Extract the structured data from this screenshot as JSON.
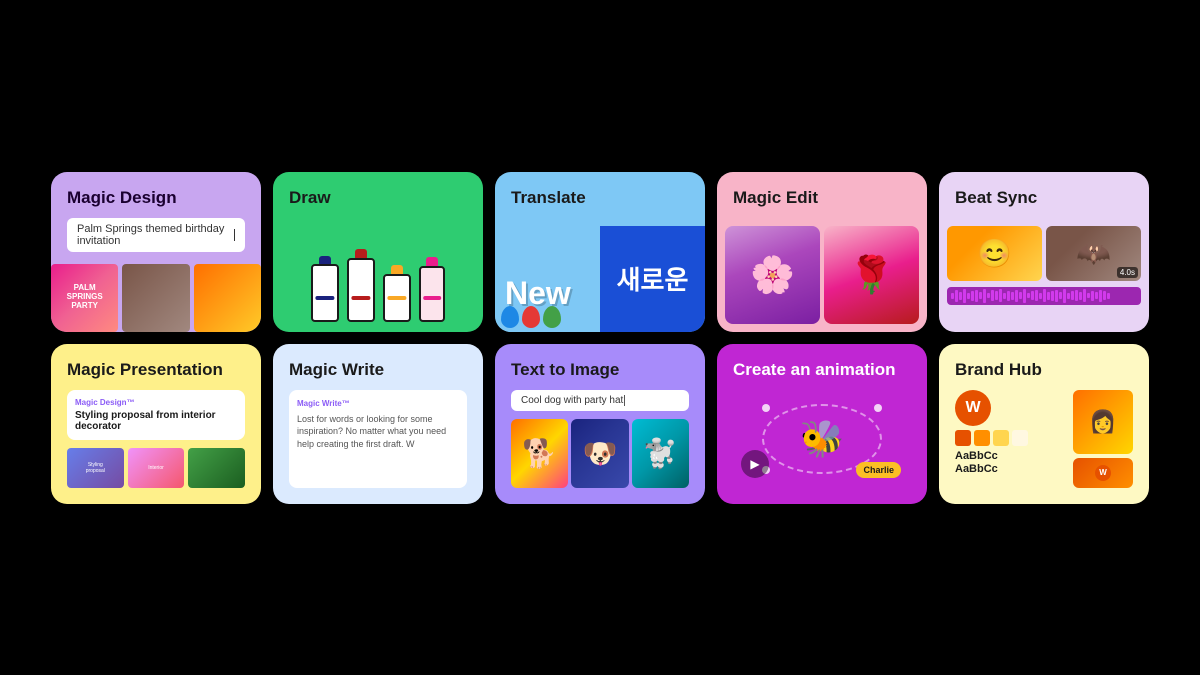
{
  "cards": {
    "magic_design": {
      "title": "Magic Design",
      "input_text": "Palm Springs themed birthday invitation",
      "images": [
        "pink-party",
        "photo",
        "bright"
      ]
    },
    "draw": {
      "title": "Draw"
    },
    "translate": {
      "title": "Translate",
      "word_new": "New",
      "word_korean": "새로운"
    },
    "magic_edit": {
      "title": "Magic Edit"
    },
    "beat_sync": {
      "title": "Beat Sync",
      "duration": "4.0s"
    },
    "magic_presentation": {
      "title": "Magic Presentation",
      "badge": "Magic Design™",
      "proposal": "Styling proposal from interior decorator"
    },
    "magic_write": {
      "title": "Magic Write",
      "badge": "Magic Write™",
      "text": "Lost for words or looking for some inspiration? No matter what you need help creating the first draft. W"
    },
    "text_to_image": {
      "title": "Text to Image",
      "input_text": "Cool dog with party hat"
    },
    "create_animation": {
      "title": "Create an animation",
      "charlie_label": "Charlie"
    },
    "brand_hub": {
      "title": "Brand Hub",
      "typography": "AaBbCc\nAaBbCc",
      "logo_letter": "W"
    }
  }
}
